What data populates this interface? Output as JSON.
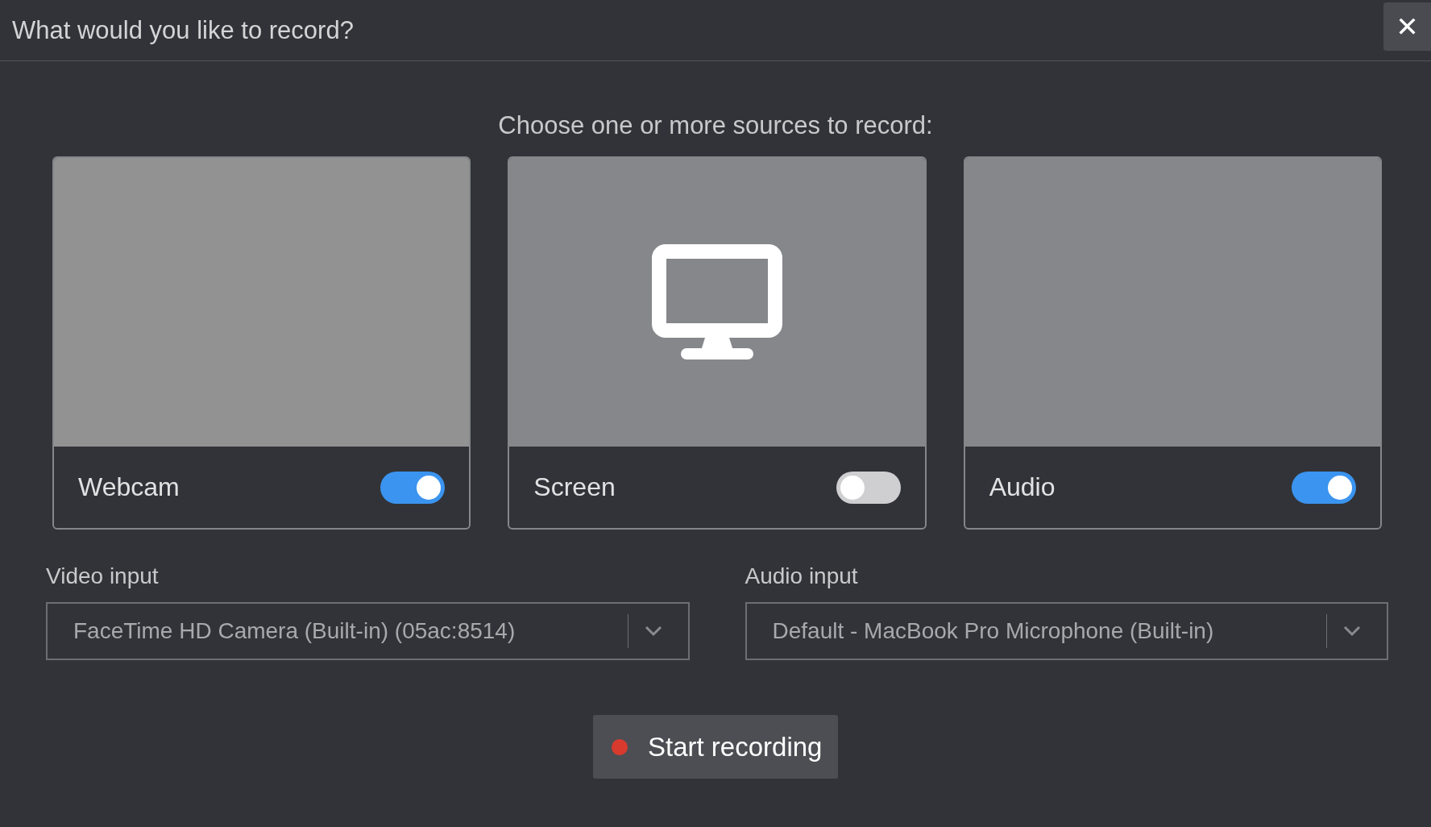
{
  "dialog": {
    "title": "What would you like to record?",
    "close": "✕"
  },
  "prompt": "Choose one or more sources to record:",
  "sources": [
    {
      "label": "Webcam",
      "on": true,
      "kind": "video"
    },
    {
      "label": "Screen",
      "on": false,
      "kind": "screen"
    },
    {
      "label": "Audio",
      "on": true,
      "kind": "audio"
    }
  ],
  "inputs": [
    {
      "label": "Video input",
      "value": "FaceTime HD Camera (Built-in) (05ac:8514)"
    },
    {
      "label": "Audio input",
      "value": "Default - MacBook Pro Microphone (Built-in)"
    }
  ],
  "start_button": {
    "label": "Start recording"
  }
}
